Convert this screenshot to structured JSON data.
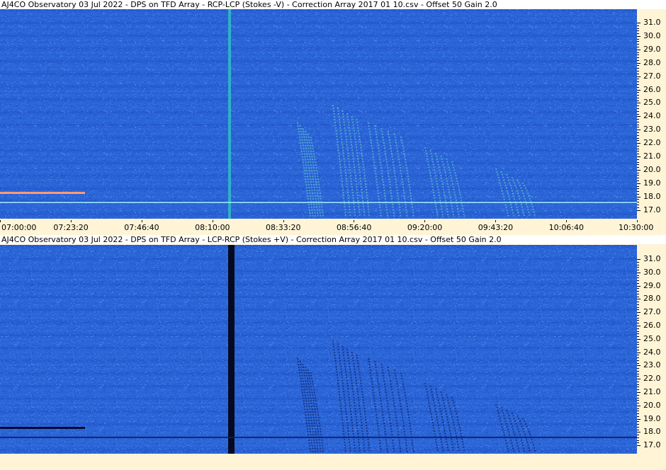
{
  "panels": [
    {
      "title": "AJ4CO Observatory 03 Jul 2022  -  DPS on TFD Array  -  RCP-LCP (Stokes -V)  -  Correction Array 2017 01 10.csv  -  Offset 50  Gain 2.0",
      "mode": "positive"
    },
    {
      "title": "AJ4CO Observatory 03 Jul 2022  -  DPS on TFD Array  -  LCP-RCP (Stokes +V)  -  Correction Array 2017 01 10.csv  -  Offset 50  Gain 2.0",
      "mode": "negative"
    }
  ],
  "freq_labels": [
    "31.0",
    "30.0",
    "29.0",
    "28.0",
    "27.0",
    "26.0",
    "25.0",
    "24.0",
    "23.0",
    "22.0",
    "21.0",
    "20.0",
    "19.0",
    "18.0",
    "17.0"
  ],
  "time_labels": [
    "07:00:00",
    "07:23:20",
    "07:46:40",
    "08:10:00",
    "08:33:20",
    "08:56:40",
    "09:20:00",
    "09:43:20",
    "10:06:40",
    "10:30:00"
  ],
  "colors": {
    "background": "#2a63d6",
    "axis_bg": "#fff5d6",
    "burst_positive": "#7ef0c8",
    "burst_negative": "#0a1a55"
  }
}
